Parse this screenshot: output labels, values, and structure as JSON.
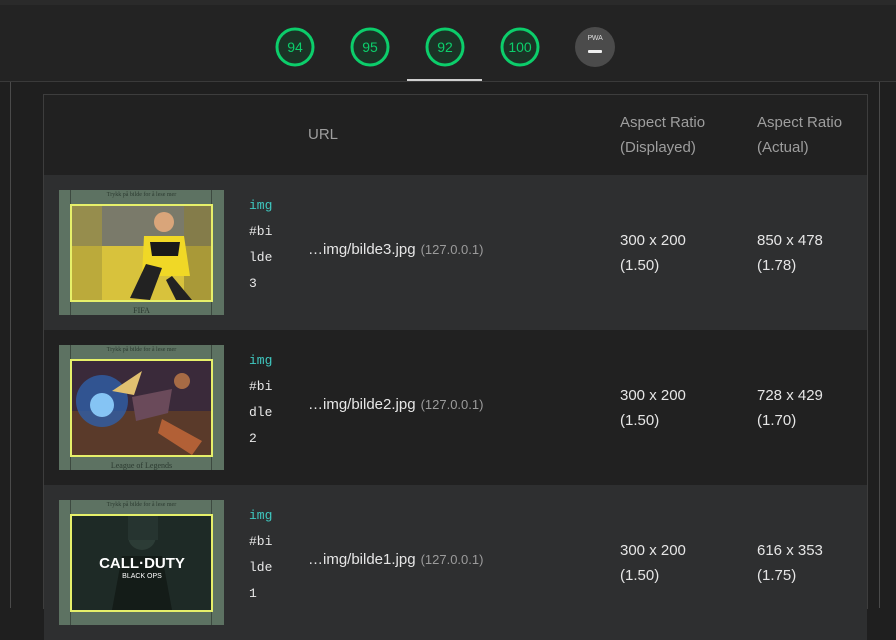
{
  "scores": [
    {
      "value": "94",
      "color": "#0cce6b"
    },
    {
      "value": "95",
      "color": "#0cce6b"
    },
    {
      "value": "92",
      "color": "#0cce6b"
    },
    {
      "value": "100",
      "color": "#0cce6b"
    }
  ],
  "pwa": {
    "label": "PWA",
    "icon": "dash-icon"
  },
  "table": {
    "headers": {
      "url": "URL",
      "displayed_line1": "Aspect Ratio",
      "displayed_line2": "(Displayed)",
      "actual_line1": "Aspect Ratio",
      "actual_line2": "(Actual)"
    },
    "rows": [
      {
        "thumb_caption_top": "Trykk på bilde for å lese mer",
        "thumb_caption_bottom": "FIFA",
        "selector_tag": "img",
        "selector_parts": [
          "#bi",
          "lde",
          "3"
        ],
        "url": "…img/bilde3.jpg",
        "host": "(127.0.0.1)",
        "displayed": "300 x 200",
        "displayed_ratio": "(1.50)",
        "actual": "850 x 478",
        "actual_ratio": "(1.78)"
      },
      {
        "thumb_caption_top": "Trykk på bilde for å lese mer",
        "thumb_caption_bottom": "League of Legends",
        "selector_tag": "img",
        "selector_parts": [
          "#bi",
          "dle",
          "2"
        ],
        "url": "…img/bilde2.jpg",
        "host": "(127.0.0.1)",
        "displayed": "300 x 200",
        "displayed_ratio": "(1.50)",
        "actual": "728 x 429",
        "actual_ratio": "(1.70)"
      },
      {
        "thumb_caption_top": "Trykk på bilde for å lese mer",
        "thumb_caption_bottom": "",
        "thumb_logo_line1": "CALL·DUTY",
        "thumb_logo_line2": "BLACK OPS",
        "selector_tag": "img",
        "selector_parts": [
          "#bi",
          "lde",
          "1"
        ],
        "url": "…img/bilde1.jpg",
        "host": "(127.0.0.1)",
        "displayed": "300 x 200",
        "displayed_ratio": "(1.50)",
        "actual": "616 x 353",
        "actual_ratio": "(1.75)"
      }
    ]
  }
}
